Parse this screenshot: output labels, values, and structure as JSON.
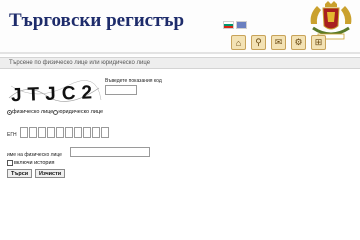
{
  "header": {
    "title": "Търговски регистър",
    "languages": [
      {
        "name": "bulgarian-flag-icon",
        "colors": [
          "#ffffff",
          "#00966e",
          "#d62612"
        ]
      },
      {
        "name": "uk-flag-icon",
        "colors": [
          "#6a7fc0"
        ]
      }
    ],
    "toolbar_icons": [
      "home-icon",
      "search-icon",
      "mail-icon",
      "settings-icon",
      "sitemap-icon"
    ]
  },
  "search": {
    "section_title": "Търсене по физическо лице или юридическо лице",
    "captcha_text": "JTJC2",
    "captcha_label": "Въведете показания код",
    "captcha_value": "",
    "person_types": [
      {
        "label": "физическо лице",
        "checked": true
      },
      {
        "label": "юридическо лице",
        "checked": false
      }
    ],
    "egn_label": "ЕГН",
    "egn_digits": 10,
    "name_label": "име на физическо лице",
    "name_value": "",
    "history_label": "включи история",
    "history_checked": false,
    "search_button": "Търси",
    "clear_button": "Изчисти"
  },
  "colors": {
    "title": "#1e2c6b",
    "section_bar": "#eeeeee"
  }
}
